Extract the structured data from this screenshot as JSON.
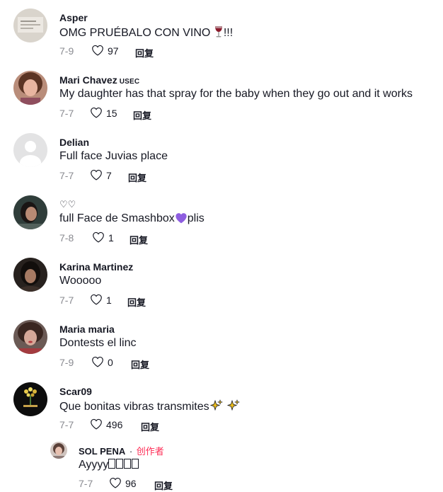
{
  "comments": [
    {
      "username": "Asper",
      "text": "OMG PRUÉBALO CON VINO ",
      "text_suffix": "!!!",
      "date": "7-9",
      "likes": "97",
      "reply": "回复"
    },
    {
      "username": "Mari Chavez",
      "tag": "USEC",
      "text": "My daughter has that spray for the baby when they go out and it works",
      "date": "7-7",
      "likes": "15",
      "reply": "回复"
    },
    {
      "username": "Delian",
      "text": "Full face Juvias place",
      "date": "7-7",
      "likes": "7",
      "reply": "回复"
    },
    {
      "username": "♡♡",
      "text": "full Face de Smashbox",
      "text_suffix": "plis",
      "date": "7-8",
      "likes": "1",
      "reply": "回复"
    },
    {
      "username": "Karina Martinez",
      "text": "Wooooo",
      "date": "7-7",
      "likes": "1",
      "reply": "回复"
    },
    {
      "username": "Maria maria",
      "text": "Dontests el linc",
      "date": "7-9",
      "likes": "0",
      "reply": "回复"
    },
    {
      "username": "Scar09",
      "text": "Que bonitas vibras transmites",
      "date": "7-7",
      "likes": "496",
      "reply": "回复"
    }
  ],
  "reply_comment": {
    "username": "SOL PENA",
    "creator_label": "创作者",
    "text": "Ayyyy",
    "date": "7-7",
    "likes": "96",
    "reply": "回复"
  },
  "icons": {
    "heart": "heart-outline-icon",
    "wine": "wine-glass-emoji",
    "purple_heart": "purple-heart-emoji",
    "sparkles": "sparkles-emoji"
  },
  "colors": {
    "text": "#161823",
    "muted": "#8a8b91",
    "creator": "#fe2c55"
  }
}
